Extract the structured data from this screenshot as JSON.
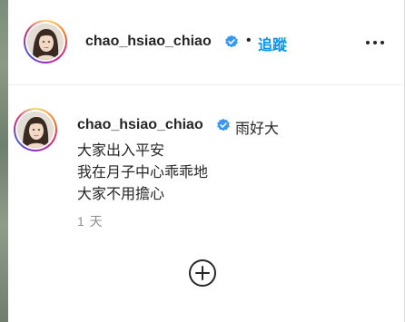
{
  "post": {
    "username": "chao_hsiao_chiao",
    "follow_label": "追蹤",
    "separator": "•"
  },
  "comment": {
    "username": "chao_hsiao_chiao",
    "caption_lines": [
      "雨好大",
      "大家出入平安",
      "我在月子中心乖乖地",
      "大家不用擔心"
    ],
    "timestamp": "1 天"
  },
  "colors": {
    "follow_blue": "#0095f6",
    "verified_blue": "#3897f0",
    "muted_gray": "#8e8e8e"
  },
  "icons": {
    "verified": "verified-badge-icon",
    "more": "more-options-icon",
    "load_more": "plus-circle-icon"
  }
}
